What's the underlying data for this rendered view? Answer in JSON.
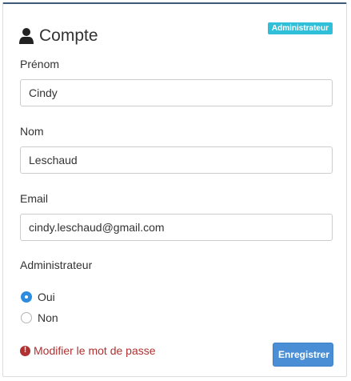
{
  "card": {
    "title": "Compte",
    "title_icon": "user-icon",
    "role_badge": "Administrateur"
  },
  "fields": {
    "prenom": {
      "label": "Prénom",
      "value": "Cindy"
    },
    "nom": {
      "label": "Nom",
      "value": "Leschaud"
    },
    "email": {
      "label": "Email",
      "value": "cindy.leschaud@gmail.com"
    }
  },
  "admin": {
    "label": "Administrateur",
    "options": [
      {
        "label": "Oui",
        "selected": true
      },
      {
        "label": "Non",
        "selected": false
      }
    ]
  },
  "actions": {
    "change_password_label": "Modifier le mot de passe",
    "change_password_icon": "exclamation-circle-icon",
    "save_label": "Enregistrer"
  },
  "colors": {
    "badge": "#2fbfd8",
    "primary_button": "#4a8fd6",
    "danger_link": "#b03131",
    "radio_selected": "#2d8ce0",
    "card_top_border": "#3c5a78"
  }
}
